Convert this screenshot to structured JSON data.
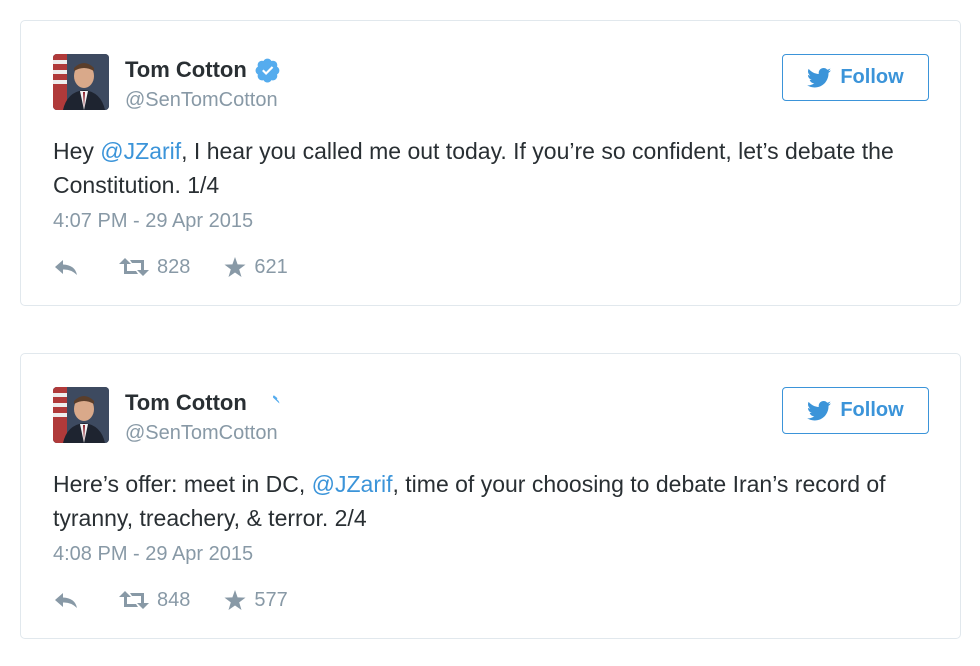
{
  "colors": {
    "link": "#3b94d9",
    "secondary": "#8899a6",
    "text": "#292f33",
    "border": "#e1e8ed"
  },
  "tweets": [
    {
      "author_name": "Tom Cotton",
      "author_handle": "@SenTomCotton",
      "follow_label": "Follow",
      "text_pre": "Hey ",
      "mention": "@JZarif",
      "text_post": ", I hear you called me out today.  If you’re so confident, let’s debate the Constitution. 1/4",
      "timestamp": "4:07 PM - 29 Apr 2015",
      "retweets": "828",
      "likes": "621",
      "icons": [
        "verified-icon",
        "twitter-bird-icon",
        "reply-icon",
        "retweet-icon",
        "star-icon"
      ]
    },
    {
      "author_name": "Tom Cotton",
      "author_handle": "@SenTomCotton",
      "follow_label": "Follow",
      "text_pre": "Here’s offer: meet in DC, ",
      "mention": "@JZarif",
      "text_post": ", time of your choosing to debate Iran’s record of tyranny, treachery, & terror. 2/4",
      "timestamp": "4:08 PM - 29 Apr 2015",
      "retweets": "848",
      "likes": "577",
      "icons": [
        "verified-icon",
        "twitter-bird-icon",
        "reply-icon",
        "retweet-icon",
        "star-icon"
      ]
    }
  ]
}
